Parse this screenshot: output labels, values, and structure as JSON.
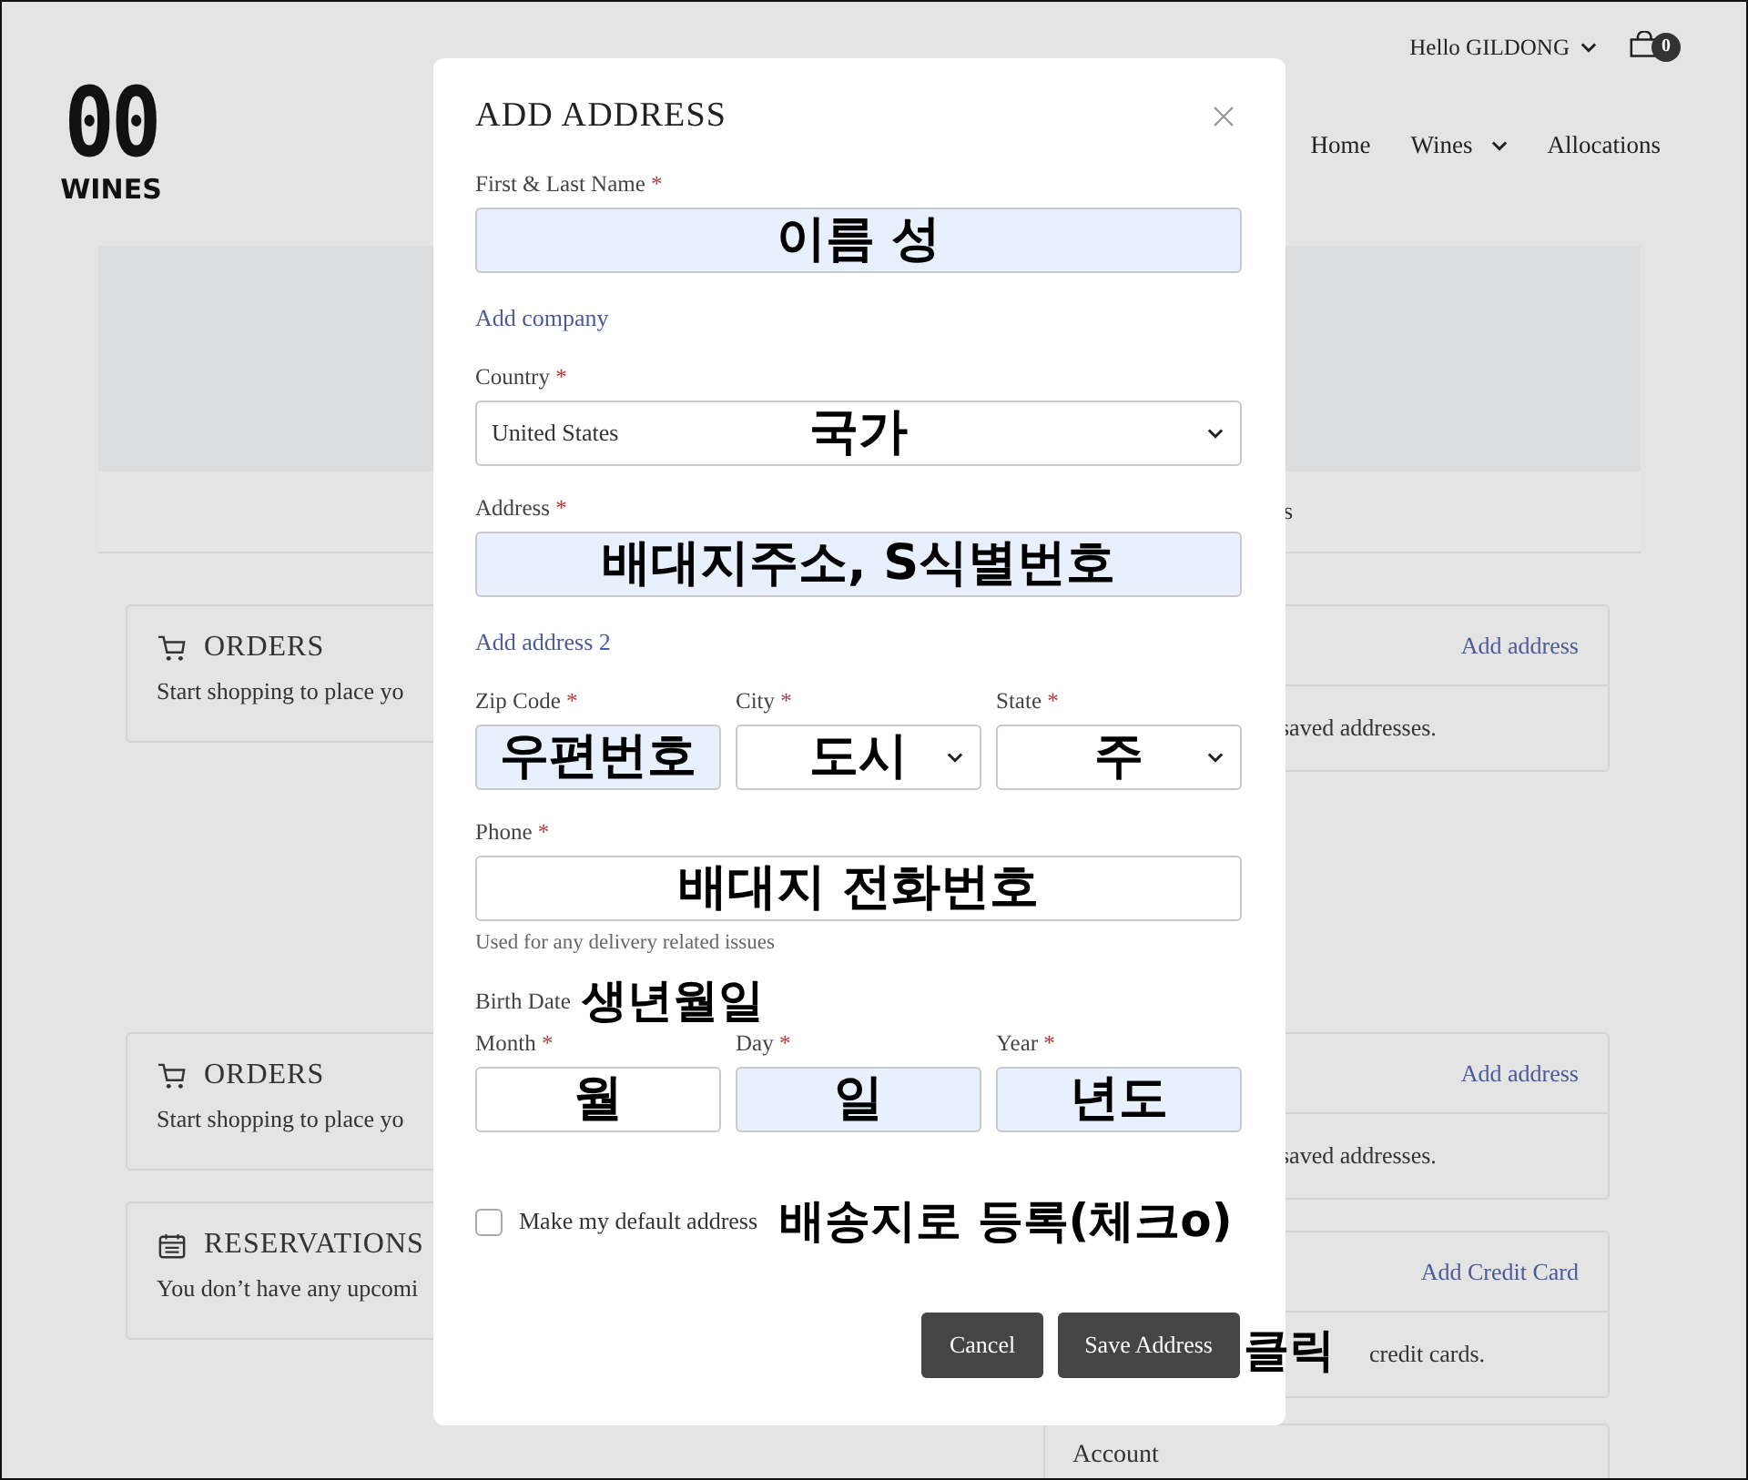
{
  "header": {
    "greeting": "Hello GILDONG",
    "cart_count": "0",
    "logo": {
      "line_1": "00",
      "line_2": "WINES"
    },
    "nav": [
      {
        "label": "Home",
        "dropdown": false
      },
      {
        "label": "Wines",
        "dropdown": true
      },
      {
        "label": "Allocations",
        "dropdown": false
      }
    ]
  },
  "banner": {
    "text": "s"
  },
  "left_cards": [
    {
      "kind": "cart",
      "title": "ORDERS",
      "text": "Start shopping to place yo"
    },
    {
      "kind": "cart",
      "title": "ORDERS",
      "text": "Start shopping to place yo"
    },
    {
      "kind": "calendar",
      "title": "RESERVATIONS",
      "text": "You don’t have any upcomi"
    }
  ],
  "right_cards": [
    {
      "kind": "action",
      "action": "Add address",
      "text": "saved addresses."
    },
    {
      "kind": "action",
      "action": "Add address",
      "text": "saved addresses."
    },
    {
      "kind": "action",
      "action": "Add Credit Card",
      "text": "credit cards."
    },
    {
      "kind": "title",
      "title": "Account"
    }
  ],
  "dialog": {
    "title": "ADD ADDRESS",
    "form": [
      {
        "kind": "fields",
        "fields": [
          {
            "label": "First & Last Name",
            "mark": "*",
            "kind": "text",
            "note": "이름 성",
            "autofilled": true
          }
        ]
      },
      {
        "kind": "link",
        "label": "Add company"
      },
      {
        "kind": "fields",
        "fields": [
          {
            "label": "Country",
            "mark": "*",
            "kind": "select",
            "value": "United States",
            "note": "국가",
            "autofilled": false
          }
        ]
      },
      {
        "kind": "fields",
        "fields": [
          {
            "label": "Address",
            "mark": "*",
            "kind": "text",
            "note": "배대지주소, S식별번호",
            "autofilled": true
          }
        ]
      },
      {
        "kind": "link",
        "label": "Add address 2"
      },
      {
        "kind": "fields",
        "fields": [
          {
            "label": "Zip Code",
            "mark": "*",
            "kind": "text",
            "note": "우편번호",
            "autofilled": true
          },
          {
            "label": "City",
            "mark": "*",
            "kind": "select",
            "note": "도시",
            "autofilled": false
          },
          {
            "label": "State",
            "mark": "*",
            "kind": "select",
            "note": "주",
            "autofilled": false
          }
        ]
      },
      {
        "kind": "fields",
        "fields": [
          {
            "label": "Phone",
            "mark": "*",
            "kind": "text",
            "note": "배대지 전화번호",
            "autofilled": false
          }
        ],
        "hint": "Used for any delivery related issues"
      },
      {
        "kind": "heading",
        "label": "Birth Date",
        "note": "생년월일"
      },
      {
        "kind": "fields",
        "fields": [
          {
            "label": "Month",
            "mark": "*",
            "kind": "text",
            "note": "월",
            "autofilled": false
          },
          {
            "label": "Day",
            "mark": "*",
            "kind": "text",
            "note": "일",
            "autofilled": true
          },
          {
            "label": "Year",
            "mark": "*",
            "kind": "text",
            "note": "년도",
            "autofilled": true
          }
        ]
      }
    ],
    "checkbox": {
      "label": "Make my default address",
      "checked": false,
      "note": "배송지로 등록(체크o)"
    },
    "buttons": [
      {
        "label": "Cancel"
      },
      {
        "label": "Save Address"
      }
    ],
    "button_note": "클릭"
  }
}
